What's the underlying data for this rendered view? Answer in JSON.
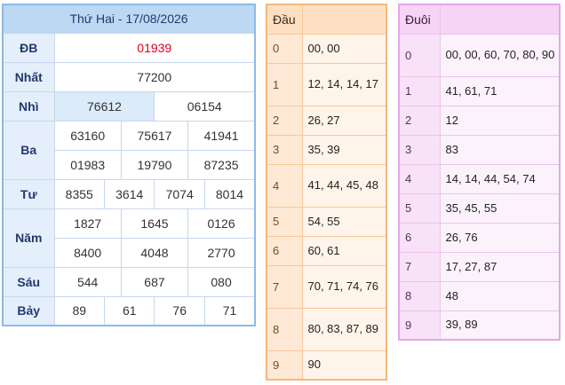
{
  "results": {
    "title": "Thứ Hai - 17/08/2026",
    "rows": [
      {
        "label": "ĐB",
        "values": [
          "01939"
        ]
      },
      {
        "label": "Nhất",
        "values": [
          "77200"
        ]
      },
      {
        "label": "Nhì",
        "values": [
          "76612",
          "06154"
        ]
      },
      {
        "label": "Ba",
        "values": [
          "63160",
          "75617",
          "41941",
          "01983",
          "19790",
          "87235"
        ]
      },
      {
        "label": "Tư",
        "values": [
          "8355",
          "3614",
          "7074",
          "8014"
        ]
      },
      {
        "label": "Năm",
        "values": [
          "1827",
          "1645",
          "0126",
          "8400",
          "4048",
          "2770"
        ]
      },
      {
        "label": "Sáu",
        "values": [
          "544",
          "687",
          "080"
        ]
      },
      {
        "label": "Bảy",
        "values": [
          "89",
          "61",
          "76",
          "71"
        ]
      }
    ]
  },
  "dau": {
    "header": "Đầu",
    "rows": [
      {
        "digit": "0",
        "values": "00, 00"
      },
      {
        "digit": "1",
        "values": "12, 14, 14, 17"
      },
      {
        "digit": "2",
        "values": "26, 27"
      },
      {
        "digit": "3",
        "values": "35, 39"
      },
      {
        "digit": "4",
        "values": "41, 44, 45, 48"
      },
      {
        "digit": "5",
        "values": "54, 55"
      },
      {
        "digit": "6",
        "values": "60, 61"
      },
      {
        "digit": "7",
        "values": "70, 71, 74, 76"
      },
      {
        "digit": "8",
        "values": "80, 83, 87, 89"
      },
      {
        "digit": "9",
        "values": "90"
      }
    ]
  },
  "duoi": {
    "header": "Đuôi",
    "rows": [
      {
        "digit": "0",
        "values": "00, 00, 60, 70, 80, 90"
      },
      {
        "digit": "1",
        "values": "41, 61, 71"
      },
      {
        "digit": "2",
        "values": "12"
      },
      {
        "digit": "3",
        "values": "83"
      },
      {
        "digit": "4",
        "values": "14, 14, 44, 54, 74"
      },
      {
        "digit": "5",
        "values": "35, 45, 55"
      },
      {
        "digit": "6",
        "values": "26, 76"
      },
      {
        "digit": "7",
        "values": "17, 27, 87"
      },
      {
        "digit": "8",
        "values": "48"
      },
      {
        "digit": "9",
        "values": "39, 89"
      }
    ]
  },
  "colors": {
    "special_prize": "#e0001b",
    "results_border": "#8db9e6",
    "dau_border": "#f8b67a",
    "duoi_border": "#e4a7e6"
  }
}
